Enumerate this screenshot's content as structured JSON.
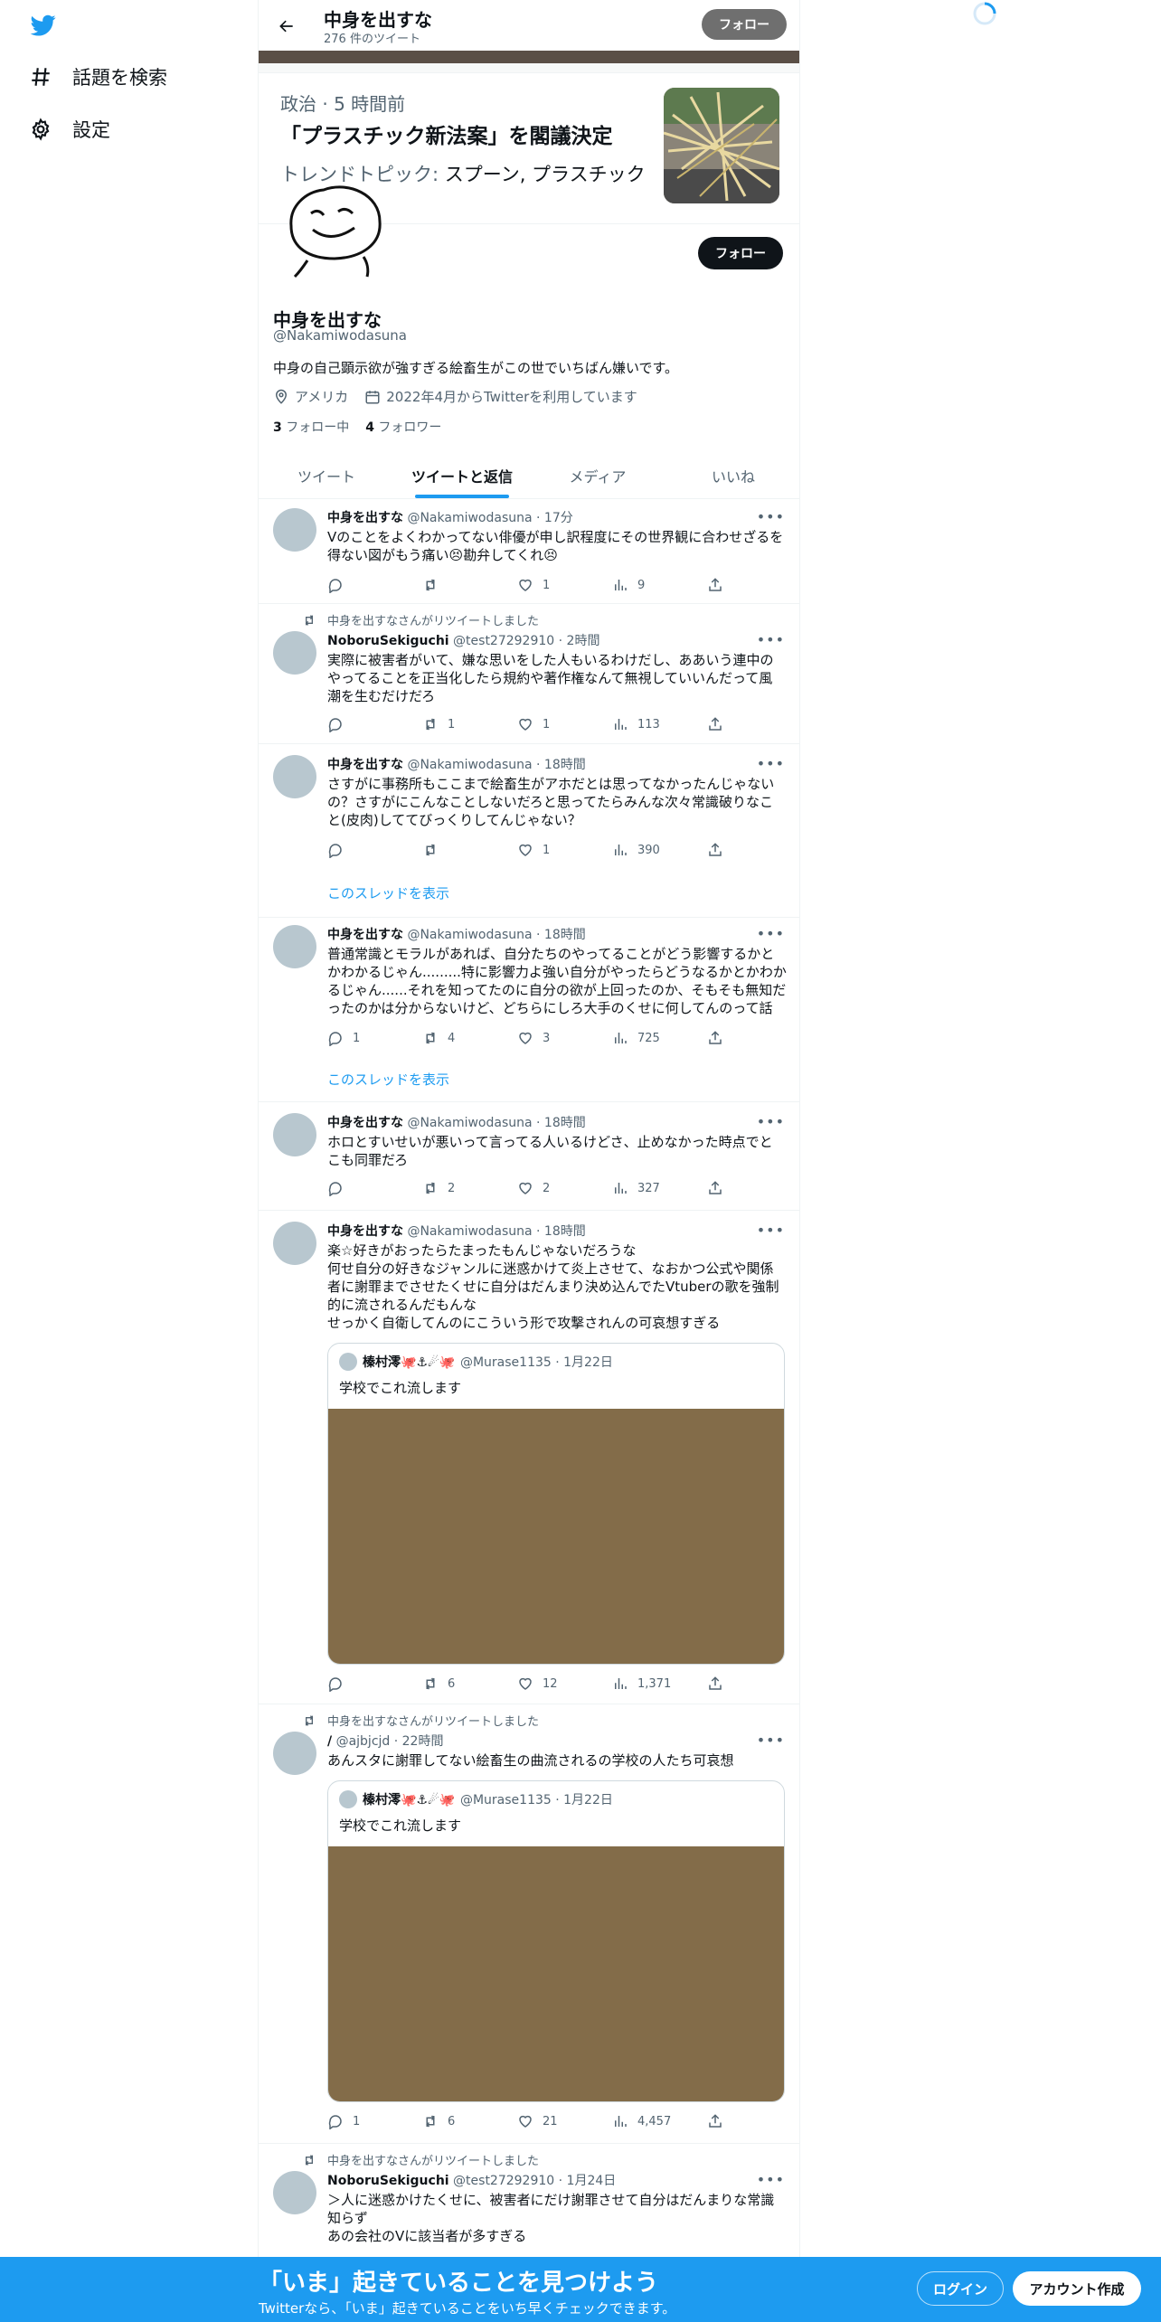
{
  "nav": {
    "explore_label": "話題を検索",
    "settings_label": "設定"
  },
  "header": {
    "title": "中身を出すな",
    "tweet_count": "276 件のツイート",
    "follow_label": "フォロー"
  },
  "news": {
    "meta": "政治 · 5 時間前",
    "title": "「プラスチック新法案」を閣議決定",
    "topic_prefix": "トレンドトピック: ",
    "topic_keywords": "スプーン, プラスチック"
  },
  "profile": {
    "follow_label": "フォロー",
    "name": "中身を出すな",
    "handle": "@Nakamiwodasuna",
    "bio": "中身の自己顕示欲が強すぎる絵畜生がこの世でいちばん嫌いです。",
    "location": "アメリカ",
    "joined": "2022年4月からTwitterを利用しています",
    "following_count": "3",
    "following_label": "フォロー中",
    "followers_count": "4",
    "followers_label": "フォロワー"
  },
  "tabs": [
    "ツイート",
    "ツイートと返信",
    "メディア",
    "いいね"
  ],
  "thread_link": "このスレッドを表示",
  "tweets": [
    {
      "name": "中身を出すな",
      "meta": "@Nakamiwodasuna · 17分",
      "text_lines": [
        "Vのことをよくわかってない俳優が申し訳程度にその世界観に合わせざるを",
        "得ない図がもう痛い😣勘弁してくれ😣"
      ],
      "reply": "",
      "retweet": "",
      "like": "1",
      "views": "9"
    },
    {
      "retweeted_by": "中身を出すなさんがリツイートしました",
      "name": "NoboruSekiguchi",
      "meta": "@test27292910 · 2時間",
      "text_lines": [
        "実際に被害者がいて、嫌な思いをした人もいるわけだし、ああいう連中の",
        "やってることを正当化したら規約や著作権なんて無視していいんだって風",
        "潮を生むだけだろ"
      ],
      "reply": "",
      "retweet": "1",
      "like": "1",
      "views": "113"
    },
    {
      "name": "中身を出すな",
      "meta": "@Nakamiwodasuna · 18時間",
      "text_lines": [
        "さすがに事務所もここまで絵畜生がアホだとは思ってなかったんじゃない",
        "の？さすがにこんなことしないだろと思ってたらみんな次々常識破りなこ",
        "と(皮肉)しててびっくりしてんじゃない？"
      ],
      "reply": "",
      "retweet": "",
      "like": "1",
      "views": "390"
    },
    {
      "name": "中身を出すな",
      "meta": "@Nakamiwodasuna · 18時間",
      "text_lines": [
        "普通常識とモラルがあれば、自分たちのやってることがどう影響するかと",
        "かわかるじゃん.........特に影響力よ強い自分がやったらどうなるかとかわか",
        "るじゃん......それを知ってたのに自分の欲が上回ったのか、そもそも無知だ",
        "ったのかは分からないけど、どちらにしろ大手のくせに何してんのって話"
      ],
      "reply": "1",
      "retweet": "4",
      "like": "3",
      "views": "725"
    },
    {
      "name": "中身を出すな",
      "meta": "@Nakamiwodasuna · 18時間",
      "text_lines": [
        "ホロとすいせいが悪いって言ってる人いるけどさ、止めなかった時点でと",
        "こも同罪だろ"
      ],
      "reply": "",
      "retweet": "2",
      "like": "2",
      "views": "327"
    },
    {
      "name": "中身を出すな",
      "meta": "@Nakamiwodasuna · 18時間",
      "text_lines": [
        "楽☆好きがおったらたまったもんじゃないだろうな",
        "何せ自分の好きなジャンルに迷惑かけて炎上させて、なおかつ公式や関係",
        "者に謝罪までさせたくせに自分はだんまり決め込んでたVtuberの歌を強制",
        "的に流されるんだもんな",
        "せっかく自衛してんのにこういう形で攻撃されんの可哀想すぎる"
      ],
      "quote": {
        "name": "榛村澪🐙⚓☄🐙",
        "meta": "@Murase1135 · 1月22日",
        "text": "学校でこれ流します"
      },
      "reply": "",
      "retweet": "6",
      "like": "12",
      "views": "1,371"
    },
    {
      "retweeted_by": "中身を出すなさんがリツイートしました",
      "name": "/",
      "meta": "@ajbjcjd · 22時間",
      "text_lines": [
        "あんスタに謝罪してない絵畜生の曲流されるの学校の人たち可哀想"
      ],
      "quote": {
        "name": "榛村澪🐙⚓☄🐙",
        "meta": "@Murase1135 · 1月22日",
        "text": "学校でこれ流します"
      },
      "reply": "1",
      "retweet": "6",
      "like": "21",
      "views": "4,457"
    },
    {
      "retweeted_by": "中身を出すなさんがリツイートしました",
      "name": "NoboruSekiguchi",
      "meta": "@test27292910 · 1月24日",
      "text_lines": [
        "＞人に迷惑かけたくせに、被害者にだけ謝罪させて自分はだんまりな常識",
        "知らず",
        "あの会社のVに該当者が多すぎる"
      ]
    }
  ],
  "bottom_bar": {
    "title": "「いま」起きていることを見つけよう",
    "subtitle": "Twitterなら、「いま」起きていることをいち早くチェックできます。",
    "login_label": "ログイン",
    "signup_label": "アカウント作成"
  },
  "colors": {
    "accent": "#1d9bf0",
    "text": "#0f1419",
    "muted": "#536471",
    "media_placeholder": "#836c49"
  }
}
